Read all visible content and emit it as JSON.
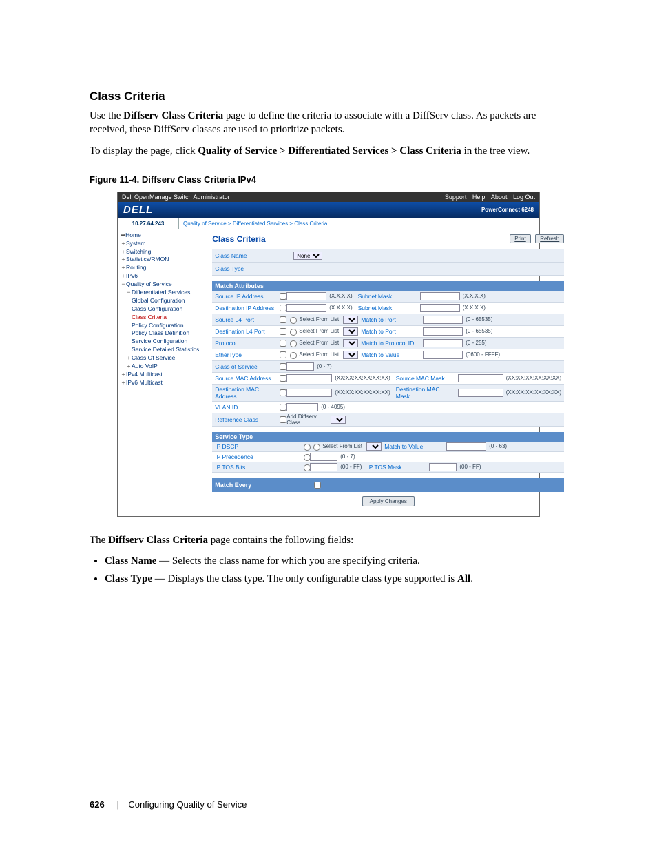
{
  "heading": "Class Criteria",
  "intro1a": "Use the ",
  "intro1b": "Diffserv Class Criteria",
  "intro1c": " page to define the criteria to associate with a DiffServ class. As packets are received, these DiffServ classes are used to prioritize packets.",
  "intro2a": "To display the page, click ",
  "intro2b": "Quality of Service > Differentiated Services > Class Criteria",
  "intro2c": " in the tree view.",
  "figcap": "Figure 11-4.   Diffserv Class Criteria IPv4",
  "postfig": "The ",
  "postfigb": "Diffserv Class Criteria",
  "postfigc": " page contains the following fields:",
  "field1b": "Class Name",
  "field1t": " — Selects the class name for which you are specifying criteria.",
  "field2b": "Class Type",
  "field2t": " — Displays the class type. The only configurable class type supported is ",
  "field2t2": "All",
  "field2t3": ".",
  "footer_page": "626",
  "footer_sec": "Configuring Quality of Service",
  "shot": {
    "title": "Dell OpenManage Switch Administrator",
    "links": {
      "support": "Support",
      "help": "Help",
      "about": "About",
      "logout": "Log Out"
    },
    "logo": "DELL",
    "model": "PowerConnect 6248",
    "ip": "10.27.64.243",
    "crumbs": [
      "Quality of Service",
      "Differentiated Services",
      "Class Criteria"
    ],
    "tree": {
      "home": "Home",
      "system": "System",
      "switching": "Switching",
      "stats": "Statistics/RMON",
      "routing": "Routing",
      "ipv6": "IPv6",
      "qos": "Quality of Service",
      "ds": "Differentiated Services",
      "gc": "Global Configuration",
      "cc": "Class Configuration",
      "ccrit": "Class Criteria",
      "pc": "Policy Configuration",
      "pcd": "Policy Class Definition",
      "sc": "Service Configuration",
      "sds": "Service Detailed Statistics",
      "cos": "Class Of Service",
      "av": "Auto VoIP",
      "ipv4m": "IPv4 Multicast",
      "ipv6m": "IPv6 Multicast"
    },
    "content": {
      "title": "Class Criteria",
      "print": "Print",
      "refresh": "Refresh",
      "classname_l": "Class Name",
      "classname_v": "None",
      "classtype_l": "Class Type",
      "sect_match": "Match Attributes",
      "sip": "Source IP Address",
      "dip": "Destination IP Address",
      "xxxx": "(X.X.X.X)",
      "snm": "Subnet Mask",
      "sl4": "Source L4 Port",
      "dl4": "Destination L4 Port",
      "proto": "Protocol",
      "eth": "EtherType",
      "cos": "Class of Service",
      "smac": "Source MAC Address",
      "dmac": "Destination MAC Address",
      "vlan": "VLAN ID",
      "ref": "Reference Class",
      "sfl": "Select From List",
      "mtp": "Match to Port",
      "mtpi": "Match to Protocol ID",
      "mtv": "Match to Value",
      "rng_port": "(0 - 65535)",
      "rng_byte": "(0 - 255)",
      "rng_cos": "(0 - 7)",
      "rng_eth": "(0600 - FFFF)",
      "rng_vlan": "(0 - 4095)",
      "rng_dscp": "(0 - 63)",
      "rng_tos": "(00 - FF)",
      "mac": "(XX:XX:XX:XX:XX:XX)",
      "smacmask": "Source MAC Mask",
      "dmacmask": "Destination MAC Mask",
      "addcls": "Add Diffserv Class",
      "sect_st": "Service Type",
      "dscp": "IP DSCP",
      "ipprec": "IP Precedence",
      "iptos": "IP TOS Bits",
      "iptosm": "IP TOS Mask",
      "sect_me": "Match Every",
      "apply": "Apply Changes"
    }
  }
}
